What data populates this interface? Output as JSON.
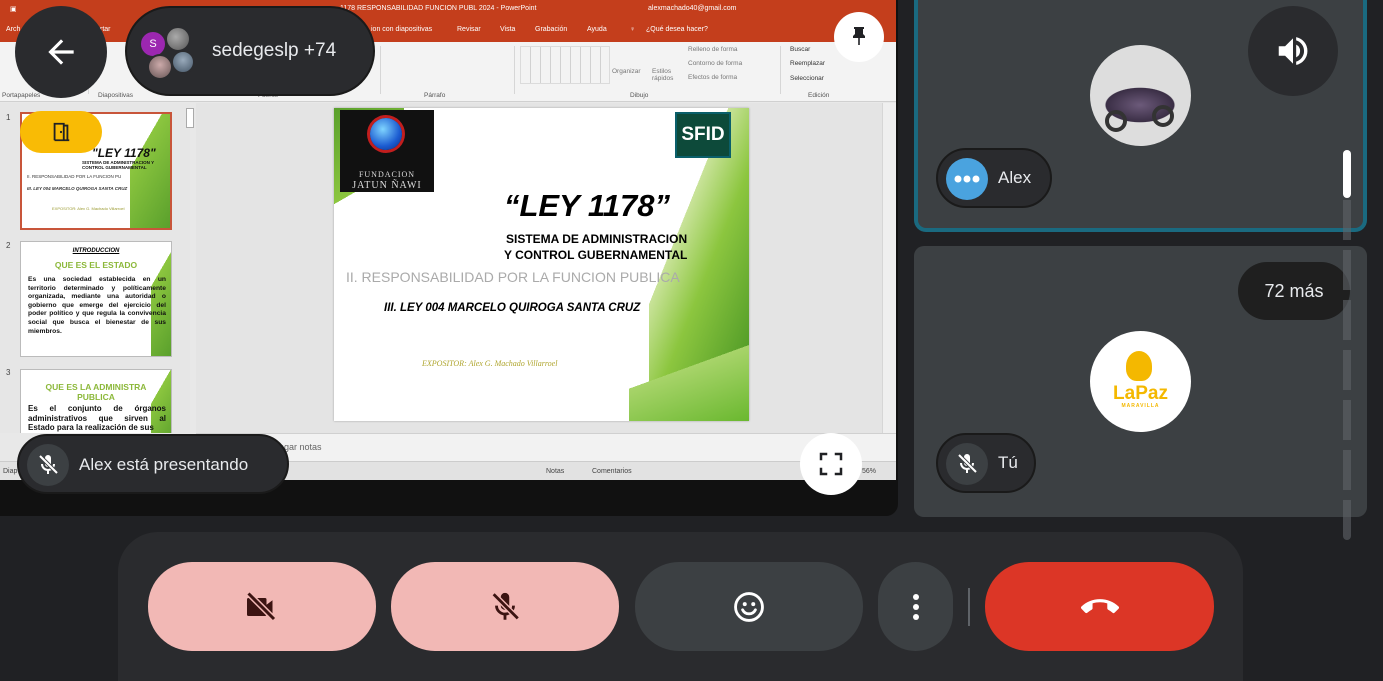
{
  "ppt": {
    "title": "1178 RESPONSABILIDAD FUNCION PUBL 2024  -  PowerPoint",
    "account": "alexmachado40@gmail.com",
    "menu": [
      "Arch",
      "rtar",
      "ion con diapositivas",
      "Revisar",
      "Vista",
      "Grabación",
      "Ayuda"
    ],
    "search_hint": "¿Qué desea hacer?",
    "ribbon_groups": {
      "clipboard": "Portapapeles",
      "slides": "Diapositivas",
      "font": "Fuente",
      "paragraph": "Párrafo",
      "drawing": "Dibujo",
      "editing": "Edición"
    },
    "ribbon_items": {
      "arrange": "Organizar",
      "quick_styles": "Estilos rápidos",
      "fill": "Relleno de forma",
      "outline": "Contorno de forma",
      "effects": "Efectos de forma",
      "find": "Buscar",
      "replace": "Reemplazar",
      "select": "Seleccionar"
    },
    "thumbnails": {
      "t1": {
        "num": "1",
        "title": "\"LEY 1178\"",
        "sub": "SISTEMA DE ADMINISTRACION Y CONTROL GUBERNAMENTAL",
        "line1": "II. RESPONSABILIDAD POR LA FUNCION PU",
        "line2": "III. LEY 004 MARCELO QUIROGA SANTA CRUZ",
        "line3": "EXPOSITOR: Alex G. Machado Villarroel"
      },
      "t2": {
        "num": "2",
        "heading": "INTRODUCCION",
        "subheading": "QUE ES EL ESTADO",
        "body": "Es una sociedad establecida en un territorio determinado y políticamente organizada, mediante una autoridad o gobierno que emerge del ejercicio del poder político y que regula la convivencia social que busca el bienestar de sus miembros."
      },
      "t3": {
        "num": "3",
        "heading": "QUE ES LA ADMINISTRA PUBLICA",
        "body": "Es el conjunto de órganos administrativos que sirven al Estado para la realización de sus"
      }
    },
    "slide": {
      "logo_left_line1": "FUNDACION",
      "logo_left_line2": "JATUN ÑAWI",
      "logo_right": "SFID",
      "title": "“LEY 1178”",
      "subtitle1": "SISTEMA DE ADMINISTRACION",
      "subtitle2": "Y CONTROL GUBERNAMENTAL",
      "line1": "II. RESPONSABILIDAD POR LA FUNCION PUBLICA",
      "line2": "III. LEY 004 MARCELO QUIROGA SANTA CRUZ",
      "expositor": "EXPOSITOR: Alex G. Machado Villarroel"
    },
    "notes_placeholder": "regar notas",
    "status": {
      "left": "Diap",
      "notes": "Notas",
      "comments": "Comentarios",
      "zoom": "56%"
    }
  },
  "meet": {
    "participants_label": "sedegeslp +74",
    "avatar_initial": "S",
    "presenting_label": "Alex está presentando",
    "tiles": {
      "alex_name": "Alex",
      "you_name": "Tú",
      "more_label": "72 más",
      "lapaz_logo": "LaPaz",
      "lapaz_sub": "MARAVILLA"
    }
  },
  "colors": {
    "ppt_accent": "#c43e1c",
    "tile_bg": "#3c4043",
    "active_speaker_border": "#1a6a80",
    "muted_button": "#f2b8b5",
    "hangup": "#dc3626"
  }
}
